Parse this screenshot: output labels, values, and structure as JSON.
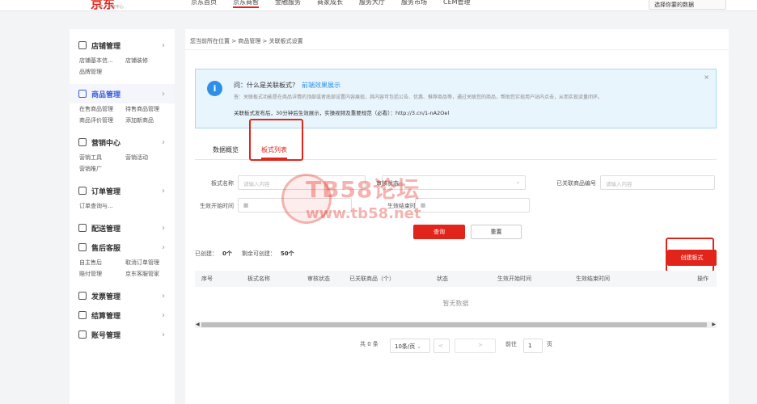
{
  "header": {
    "logo": "京东",
    "logo_sub": "京麦 · 商家中心",
    "nav": [
      "京东首页",
      "京东商智",
      "金融服务",
      "商家成长",
      "服务大厅",
      "服务市场",
      "CEM管理"
    ],
    "shop_selector": "选择你要的数据"
  },
  "sidebar": {
    "groups": [
      {
        "label": "店铺管理",
        "icon": "store-icon",
        "items": [
          "店铺基本信...",
          "店铺装修",
          "品牌管理"
        ]
      },
      {
        "label": "商品管理",
        "icon": "product-icon",
        "active": true,
        "items": [
          "在售商品管理",
          "待售商品管理",
          "商品评价管理",
          "添加新商品"
        ]
      },
      {
        "label": "营销中心",
        "icon": "marketing-icon",
        "items": [
          "营销工具",
          "营销活动",
          "营销推广"
        ]
      },
      {
        "label": "订单管理",
        "icon": "order-icon",
        "items": [
          "订单查询与..."
        ]
      },
      {
        "label": "配送管理",
        "icon": "delivery-icon",
        "items": []
      },
      {
        "label": "售后客服",
        "icon": "service-icon",
        "items": [
          "自主售后",
          "取消订单管理",
          "赔付管理",
          "京东客服管家"
        ]
      },
      {
        "label": "发票管理",
        "icon": "invoice-icon",
        "items": []
      },
      {
        "label": "结算管理",
        "icon": "settlement-icon",
        "items": []
      },
      {
        "label": "账号管理",
        "icon": "account-icon",
        "items": []
      }
    ]
  },
  "breadcrumb": "您当前所在位置 > 商品管理 > 关联板式设置",
  "notice": {
    "question": "问：什么是关联板式？",
    "link": "前端效果展示",
    "answer": "答：关联板式功能是在商品详情的顶部或者底部设置内容展现，其内容可包括公告、优惠、推荐商品等，通过关联您的商品，帮助您实现用户站内点击，从而实现流量闭环。",
    "video": "关联板式发布后，30分钟后生效展示，实操视频及重要规范（必看）：http://3.cn/1-nA2Oel",
    "close": "×"
  },
  "tabs": [
    "数据概览",
    "板式列表"
  ],
  "filters": {
    "name_label": "板式名称",
    "name_placeholder": "请输入内容",
    "status_label": "审核状态",
    "status_placeholder": "请选择",
    "product_label": "已关联商品编号",
    "product_placeholder": "请输入内容",
    "start_label": "生效开始时间",
    "end_label": "生效结束时间",
    "query": "查询",
    "reset": "重置"
  },
  "counts": {
    "created_label": "已创建：",
    "created": "0个",
    "remaining_label": "剩余可创建：",
    "remaining": "50个"
  },
  "create_button": "创建板式",
  "table": {
    "columns": [
      "序号",
      "板式名称",
      "审核状态",
      "已关联商品（个）",
      "状态",
      "生效开始时间",
      "生效结束时间",
      "操作"
    ],
    "empty": "暂无数据"
  },
  "pagination": {
    "total": "共 0 条",
    "page_size": "10条/页",
    "prev": "<",
    "next": ">",
    "goto_label": "前往",
    "goto_value": "1",
    "page_suffix": "页"
  },
  "watermark": {
    "text": "TB58论坛",
    "url": "www.tb58.net"
  }
}
